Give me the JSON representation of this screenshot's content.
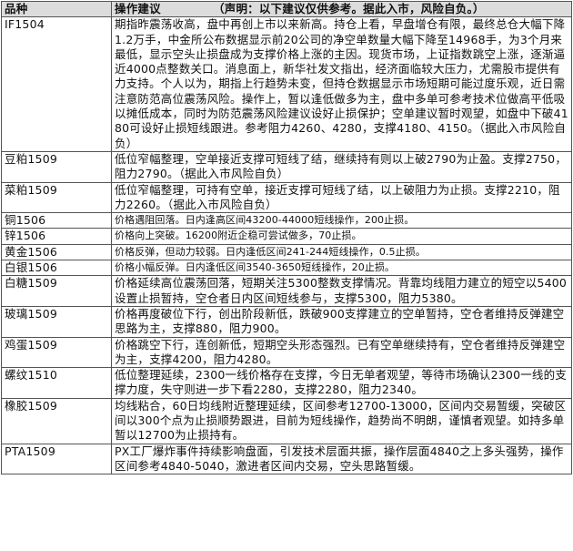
{
  "header": {
    "variety": "品种",
    "advice": "操作建议",
    "disclaimer": "（声明：以下建议仅供参考。据此入市，风险自负。）"
  },
  "rows": [
    {
      "variety": "IF1504",
      "text": "期指昨震荡收高，盘中再创上市以来新高。持仓上看，早盘增仓有限，最终总仓大幅下降1.2万手，中金所公布数据显示前20公司的净空单数量大幅下降至14968手，为3个月来最低，显示空头止损盘成为支撑价格上涨的主因。现货市场，上证指数跳空上涨，逐渐逼近4000点整数关口。消息面上，新华社发文指出，经济面临较大压力，尤需股市提供有力支持。个人以为，期指上行趋势未变，但持仓数据显示市场短期可能过度乐观，近日需注意防范高位震荡风险。操作上，暂以逢低做多为主，盘中多单可参考技术位做高平低吸以摊低成本，同时为防范震荡风险建议设好止损保护；空单建议暂时观望，如盘中下破4180可设好止损短线跟进。参考阻力4260、4280，支撑4180、4150。（据此入市风险自负）",
      "small": false
    },
    {
      "variety": "豆粕1509",
      "text": "低位窄幅整理，空单接近支撑可短线了结，继续持有则以上破2790为止盈。支撑2750，阻力2790。（据此入市风险自负）",
      "small": false
    },
    {
      "variety": "菜粕1509",
      "text": "低位窄幅整理，可持有空单，接近支撑可短线了结，以上破阻力为止损。支撑2210，阻力2260。（据此入市风险自负）",
      "small": false
    },
    {
      "variety": "铜1506",
      "text": "价格遇阻回落。日内逢高区间43200-44000短线操作，200止损。",
      "small": true
    },
    {
      "variety": "锌1506",
      "text": "价格向上突破。16200附近企稳可尝试做多，70止损。",
      "small": true
    },
    {
      "variety": "黄金1506",
      "text": "价格反弹，但动力较弱。日内逢低区间241-244短线操作，0.5止损。",
      "small": true
    },
    {
      "variety": "白银1506",
      "text": "价格小幅反弹。日内逢低区间3540-3650短线操作，20止损。",
      "small": true
    },
    {
      "variety": "白糖1509",
      "text": "价格延续高位震荡回落，短期关注5300整数支撑情况。背靠均线阻力建立的短空以5400设置止损暂持，空仓者日内区间短线参与，支撑5300，阻力5380。",
      "small": false
    },
    {
      "variety": "玻璃1509",
      "text": "价格再度破位下行，创出阶段新低，跌破900支撑建立的空单暂持，空仓者维持反弹建空思路为主，支撑880，阻力900。",
      "small": false
    },
    {
      "variety": "鸡蛋1509",
      "text": "价格跳空下行，连创新低，短期空头形态强烈。已有空单继续持有，空仓者维持反弹建空为主，支撑4200，阻力4280。",
      "small": false
    },
    {
      "variety": "螺纹1510",
      "text": "低位整理延续，2300一线价格存在支撑，今日无单者观望，等待市场确认2300一线的支撑力度，失守则进一步下看2280，支撑2280，阻力2340。",
      "small": false
    },
    {
      "variety": "橡胶1509",
      "text": "均线粘合，60日均线附近整理延续，区间参考12700-13000，区间内交易暂缓，突破区间以300个点为止损顺势跟进，目前为短线操作，趋势尚不明朗，谨慎者观望。如持多单暂以12700为止损持有。",
      "small": false
    },
    {
      "variety": "PTA1509",
      "text": "PX工厂爆炸事件持续影响盘面，引发技术层面共振，操作层面4840之上多头强势，操作区间参考4840-5040，激进者区间内交易，空头思路暂缓。",
      "small": false
    }
  ]
}
